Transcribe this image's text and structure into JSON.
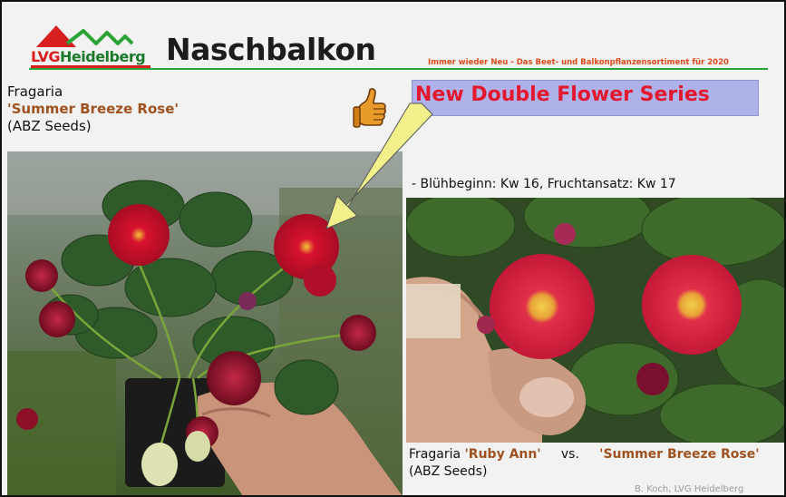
{
  "header": {
    "logo_lvg": "LVG",
    "logo_place": "Heidelberg",
    "title": "Naschbalkon",
    "tagline": "Immer wieder Neu - Das Beet- und Balkonpflanzensortiment für 2020"
  },
  "left_block": {
    "genus": "Fragaria",
    "cultivar": "'Summer Breeze Rose'",
    "supplier": "(ABZ Seeds)"
  },
  "highlight": "New Double Flower Series",
  "bullet": "-    Blühbeginn: Kw 16, Fruchtansatz: Kw 17",
  "caption": {
    "prefix": "Fragaria ",
    "cultivar_a": "'Ruby Ann'",
    "vs": "     vs.     ",
    "cultivar_b": "'Summer Breeze Rose'",
    "supplier": "(ABZ Seeds)"
  },
  "credit": "B. Koch, LVG Heidelberg",
  "colors": {
    "logo_red": "#d81e1e",
    "logo_green": "#1a7a2a",
    "rule_green": "#2aa236",
    "highlight_bg": "#aeb2e8",
    "highlight_text": "#e3182e",
    "cultivar_brown": "#a0521e",
    "arrow_fill": "#f2f08a"
  },
  "icons": [
    "thumbs-up-icon",
    "arrow-pointer-icon"
  ]
}
